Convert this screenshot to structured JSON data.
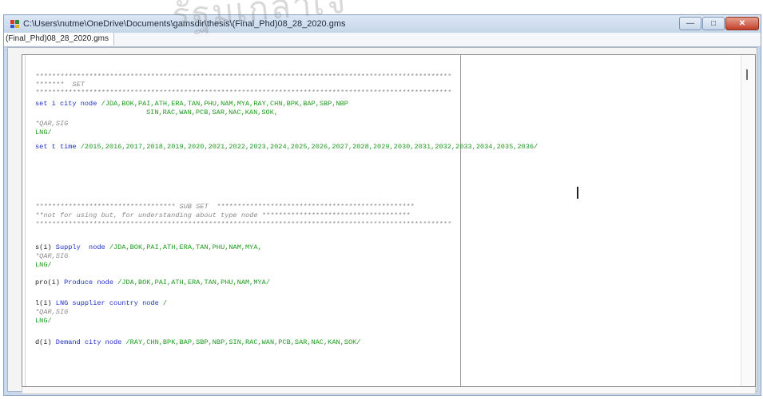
{
  "window": {
    "title": "C:\\Users\\nutme\\OneDrive\\Documents\\gamsdir\\thesis\\(Final_Phd)08_28_2020.gms",
    "icon": "gams-app-icon",
    "controls": {
      "minimize": "—",
      "maximize": "□",
      "close": "✕"
    }
  },
  "tab": {
    "label": "(Final_Phd)08_28_2020.gms"
  },
  "watermark": "รัฐมเกล้าเจ",
  "colors": {
    "keyword": "#1f30c8",
    "element": "#1f9a1f",
    "comment": "#8a8a8a"
  },
  "code": {
    "l1": "*****************************************************************************************************",
    "l2": "*******  SET",
    "l3": "*****************************************************************************************************",
    "l4_kw": "set",
    "l4_id": " i city node ",
    "l4_el": "/JDA,BOK,PAI,ATH,ERA,TAN,PHU,NAM,MYA,RAY,CHN,BPK,BAP,SBP,NBP",
    "l5_el": "SIN,RAC,WAN,PCB,SAR,NAC,KAN,SOK,",
    "l6": "*QAR,SIG",
    "l7": "LNG/",
    "l8_kw": "set",
    "l8_id": " t time ",
    "l8_el": "/2015,2016,2017,2018,2019,2020,2021,2022,2023,2024,2025,2026,2027,2028,2029,2030,2031,2032,2033,2034,2035,2036/",
    "l9": "********************************** SUB SET  ************************************************",
    "l10": "**not for using but, for understanding about type node ************************************",
    "l11": "*****************************************************************************************************",
    "l12_pre": "s(i)",
    "l12_id": " Supply  node ",
    "l12_el": "/JDA,BOK,PAI,ATH,ERA,TAN,PHU,NAM,MYA,",
    "l13": "*QAR,SIG",
    "l14": "LNG/",
    "l15_pre": "pro(i)",
    "l15_id": " Produce node ",
    "l15_el": "/JDA,BOK,PAI,ATH,ERA,TAN,PHU,NAM,MYA/",
    "l16_pre": "l(i)",
    "l16_id": " LNG supplier country node ",
    "l16_el": "/",
    "l17": "*QAR,SIG",
    "l18": "LNG/",
    "l19_pre": "d(i)",
    "l19_id": " Demand city node ",
    "l19_el": "/RAY,CHN,BPK,BAP,SBP,NBP,SIN,RAC,WAN,PCB,SAR,NAC,KAN,SOK/"
  }
}
